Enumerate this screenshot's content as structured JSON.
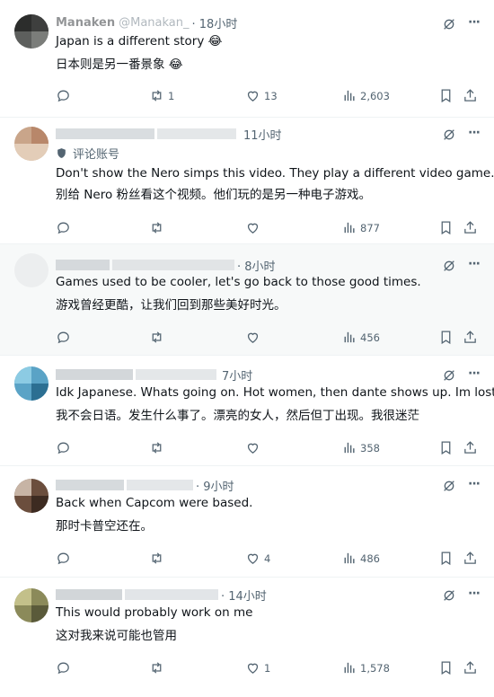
{
  "colors": {
    "text": "#0f1419",
    "muted": "#536471",
    "border": "#eff3f4",
    "highlight": "#f7f9f9"
  },
  "icons": [
    "reply-icon",
    "retweet-icon",
    "like-icon",
    "views-icon",
    "bookmark-icon",
    "share-icon",
    "grok-icon",
    "more-icon",
    "shield-icon"
  ],
  "tweets": [
    {
      "name": "Manaken",
      "handle": "@Manakan_",
      "time": "· 18小时",
      "text": "Japan is a different story 😂",
      "translation": "日本则是另一番景象 😂",
      "replies": "",
      "reposts": "1",
      "likes": "13",
      "views": "2,603"
    },
    {
      "name": "",
      "handle": "",
      "time": "11小时",
      "label": "评论账号",
      "text": "Don't show the Nero simps this video. They play a different video game.",
      "translation": "别给 Nero 粉丝看这个视频。他们玩的是另一种电子游戏。",
      "replies": "",
      "reposts": "",
      "likes": "",
      "views": "877"
    },
    {
      "name": "",
      "handle": "",
      "time": "· 8小时",
      "text": "Games used to be cooler, let's go back to those good times.",
      "translation": "游戏曾经更酷，让我们回到那些美好时光。",
      "replies": "",
      "reposts": "",
      "likes": "",
      "views": "456"
    },
    {
      "name": "",
      "handle": "",
      "time": "7小时",
      "text": "Idk Japanese. Whats going on. Hot women, then dante shows up. Im lost",
      "translation": "我不会日语。发生什么事了。漂亮的女人，然后但丁出现。我很迷茫",
      "replies": "",
      "reposts": "",
      "likes": "",
      "views": "358"
    },
    {
      "name": "",
      "handle": "",
      "time": "· 9小时",
      "text": "Back when Capcom were based.",
      "translation": "那时卡普空还在。",
      "replies": "",
      "reposts": "",
      "likes": "4",
      "views": "486"
    },
    {
      "name": "",
      "handle": "",
      "time": "· 14小时",
      "text": "This would probably work on me",
      "translation": "这对我来说可能也管用",
      "replies": "",
      "reposts": "",
      "likes": "1",
      "views": "1,578"
    }
  ]
}
